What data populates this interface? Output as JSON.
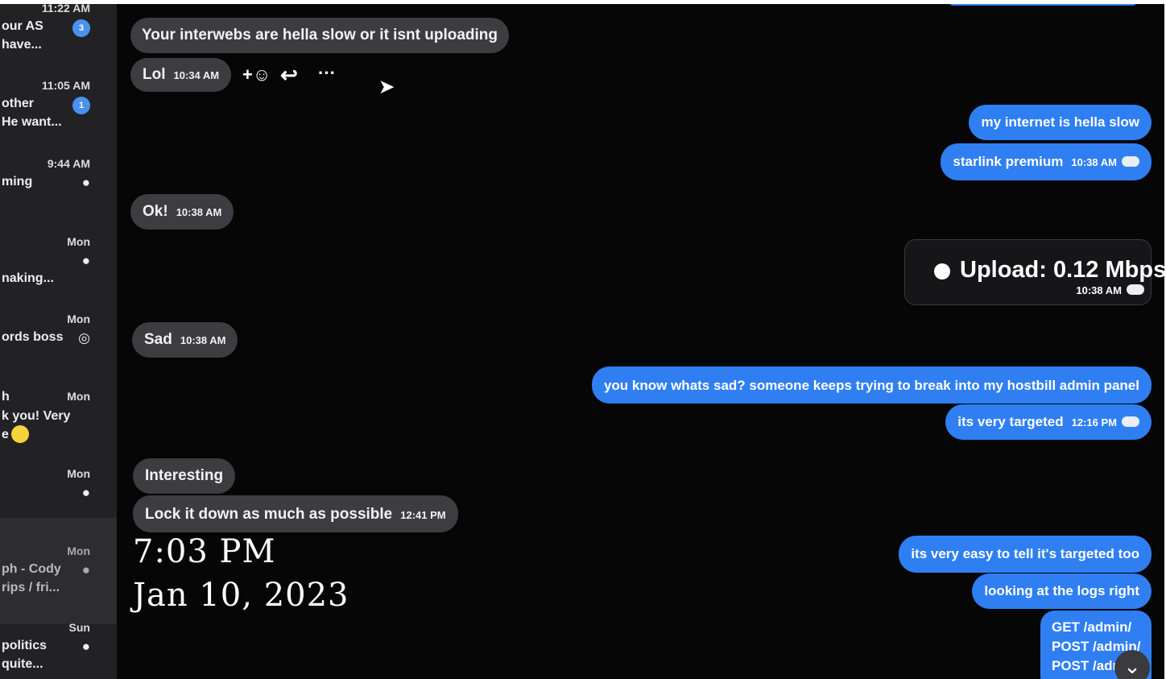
{
  "sidebar": {
    "conversations": [
      {
        "time": "11:22 AM",
        "line1": "our AS",
        "line2": "have...",
        "badge": "3"
      },
      {
        "time": "11:05 AM",
        "line1": "other",
        "line2": "He want...",
        "badge": "1"
      },
      {
        "time": "9:44 AM",
        "line1": "ming",
        "line2": "",
        "badge": ""
      },
      {
        "time": "Mon",
        "line1": "",
        "line2": "naking...",
        "badge": ""
      },
      {
        "time": "Mon",
        "line1": "ords boss",
        "line2": "",
        "badge": ""
      },
      {
        "time": "Mon",
        "line1": "h",
        "line2": "k you! Very",
        "line3": "e",
        "badge": ""
      },
      {
        "time": "Mon",
        "line1": "",
        "line2": "",
        "badge": ""
      },
      {
        "time": "Mon",
        "line1": "ph - Cody",
        "line2": "rips / fri...",
        "badge": ""
      },
      {
        "time": "Sun",
        "line1": "politics",
        "line2": "quite...",
        "badge": ""
      }
    ]
  },
  "messages": {
    "incoming": [
      {
        "text": "Your interwebs are hella slow or it isnt uploading",
        "time": ""
      },
      {
        "text": "Lol",
        "time": "10:34 AM"
      },
      {
        "text": "Ok!",
        "time": "10:38 AM"
      },
      {
        "text": "Sad",
        "time": "10:38 AM"
      },
      {
        "text": "Interesting",
        "time": ""
      },
      {
        "text": "Lock it down as much as possible",
        "time": "12:41 PM"
      }
    ],
    "outgoing": [
      {
        "text": "my internet is hella slow",
        "time": ""
      },
      {
        "text": "starlink premium",
        "time": "10:38 AM"
      },
      {
        "text": "you know whats sad? someone keeps trying to break into my hostbill admin panel",
        "time": ""
      },
      {
        "text": "its very targeted",
        "time": "12:16 PM"
      },
      {
        "text": "its very easy to tell it's targeted too",
        "time": ""
      },
      {
        "text": "looking at the logs right",
        "time": ""
      },
      {
        "text": "GET /admin/",
        "time": ""
      },
      {
        "text": "POST /admin/",
        "time": ""
      },
      {
        "text": "POST /adr",
        "time": ""
      }
    ],
    "upload_card": {
      "label": "Upload: 0.12 Mbps",
      "time": "10:38 AM"
    }
  },
  "reactions": {
    "add_reaction": "+☺",
    "reply": "↩",
    "more": "···"
  },
  "overlay": {
    "time": "7:03 PM",
    "date": "Jan 10, 2023"
  },
  "scroll_down_icon": "⌄",
  "colors": {
    "outgoing": "#2f7ff3",
    "incoming": "#3d3d41",
    "background": "#060606",
    "sidebar": "#222225"
  }
}
